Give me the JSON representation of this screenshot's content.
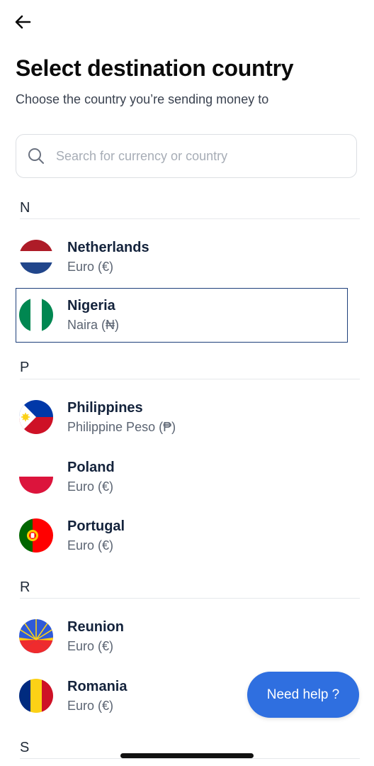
{
  "header": {
    "title": "Select destination country",
    "subtitle": "Choose the country you’re sending money to"
  },
  "search": {
    "placeholder": "Search for currency or country",
    "value": ""
  },
  "sections": [
    {
      "letter": "N",
      "countries": [
        {
          "name": "Netherlands",
          "currency": "Euro (€)",
          "flag": "netherlands-flag-icon",
          "selected": false
        },
        {
          "name": "Nigeria",
          "currency": "Naira (₦)",
          "flag": "nigeria-flag-icon",
          "selected": true
        }
      ]
    },
    {
      "letter": "P",
      "countries": [
        {
          "name": "Philippines",
          "currency": "Philippine Peso (₱)",
          "flag": "philippines-flag-icon",
          "selected": false
        },
        {
          "name": "Poland",
          "currency": "Euro (€)",
          "flag": "poland-flag-icon",
          "selected": false
        },
        {
          "name": "Portugal",
          "currency": "Euro (€)",
          "flag": "portugal-flag-icon",
          "selected": false
        }
      ]
    },
    {
      "letter": "R",
      "countries": [
        {
          "name": "Reunion",
          "currency": "Euro (€)",
          "flag": "reunion-flag-icon",
          "selected": false
        },
        {
          "name": "Romania",
          "currency": "Euro (€)",
          "flag": "romania-flag-icon",
          "selected": false
        }
      ]
    },
    {
      "letter": "S",
      "countries": []
    }
  ],
  "help_button": {
    "label": "Need help ?"
  },
  "colors": {
    "accent": "#2f6fe0",
    "selected_border": "#1d3f7a",
    "title": "#0b0b0b",
    "muted": "#5b6472"
  },
  "icons": {
    "back": "arrow-left-icon",
    "search": "search-icon"
  }
}
